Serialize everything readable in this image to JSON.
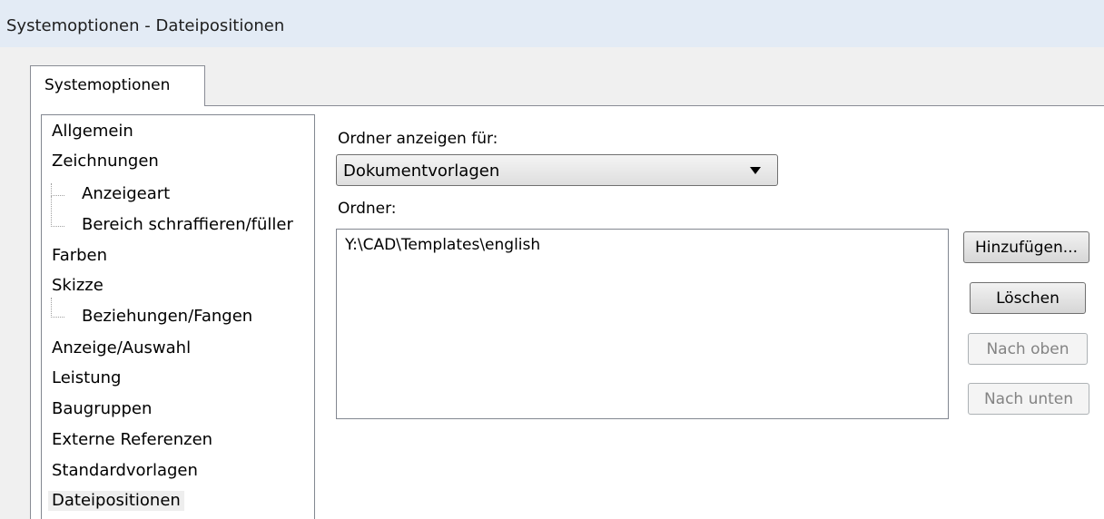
{
  "window": {
    "title": "Systemoptionen - Dateipositionen"
  },
  "tabs": [
    {
      "label": "Systemoptionen",
      "active": true
    }
  ],
  "tree": {
    "items": [
      {
        "label": "Allgemein",
        "level": 0
      },
      {
        "label": "Zeichnungen",
        "level": 0
      },
      {
        "label": "Anzeigeart",
        "level": 1
      },
      {
        "label": "Bereich schraffieren/füller",
        "level": 1
      },
      {
        "label": "Farben",
        "level": 0
      },
      {
        "label": "Skizze",
        "level": 0
      },
      {
        "label": "Beziehungen/Fangen",
        "level": 1
      },
      {
        "label": "Anzeige/Auswahl",
        "level": 0
      },
      {
        "label": "Leistung",
        "level": 0
      },
      {
        "label": "Baugruppen",
        "level": 0
      },
      {
        "label": "Externe Referenzen",
        "level": 0
      },
      {
        "label": "Standardvorlagen",
        "level": 0
      },
      {
        "label": "Dateipositionen",
        "level": 0,
        "selected": true
      }
    ]
  },
  "main": {
    "show_folders_label": "Ordner anzeigen für:",
    "show_folders_value": "Dokumentvorlagen",
    "folders_label": "Ordner:",
    "folders": [
      "Y:\\CAD\\Templates\\english"
    ]
  },
  "buttons": {
    "add": {
      "label": "Hinzufügen...",
      "enabled": true
    },
    "delete": {
      "label": "Löschen",
      "enabled": true
    },
    "move_up": {
      "label": "Nach oben",
      "enabled": false
    },
    "move_down": {
      "label": "Nach unten",
      "enabled": false
    }
  },
  "colors": {
    "titlebar": "#e3ebf5",
    "selection": "#eeeeee",
    "disabled_text": "#838383"
  }
}
